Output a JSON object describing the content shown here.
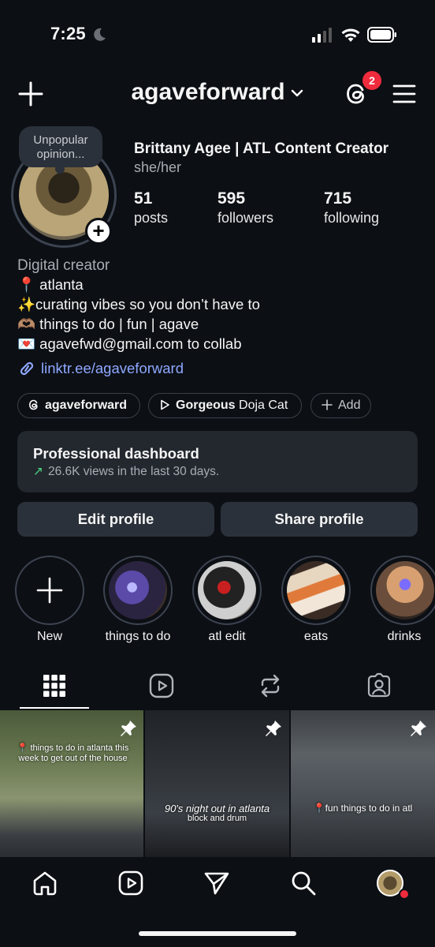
{
  "status": {
    "time": "7:25"
  },
  "header": {
    "username": "agaveforward",
    "threads_badge": "2"
  },
  "profile": {
    "note": "Unpopular opinion...",
    "name": "Brittany Agee | ATL Content Creator",
    "pronouns": "she/her",
    "stats": [
      {
        "value": "51",
        "label": "posts"
      },
      {
        "value": "595",
        "label": "followers"
      },
      {
        "value": "715",
        "label": "following"
      }
    ],
    "category": "Digital creator",
    "bio": [
      "📍 atlanta",
      "✨curating vibes so you don’t have to",
      "🫶🏽 things to do | fun | agave",
      "💌 agavefwd@gmail.com to collab"
    ],
    "link": "linktr.ee/agaveforward",
    "chips": {
      "threads": "agaveforward",
      "music_song": "Gorgeous",
      "music_artist": "Doja Cat",
      "add": "Add"
    }
  },
  "dashboard": {
    "title": "Professional dashboard",
    "arrow": "↗",
    "subtitle": "26.6K views in the last 30 days."
  },
  "buttons": {
    "edit": "Edit profile",
    "share": "Share profile"
  },
  "highlights": [
    "New",
    "things to do",
    "atl edit",
    "eats",
    "drinks"
  ],
  "grid": [
    {
      "caption": "📍 things to do in atlanta this week to get out of the house"
    },
    {
      "caption": "90's night out in atlanta",
      "sub": "block and drum"
    },
    {
      "caption": "📍fun things to do in atl"
    }
  ],
  "colors": {
    "background": "#0c0f14",
    "link": "#8fa8ff",
    "badge": "#ef2b3d",
    "trend": "#4cd080"
  }
}
